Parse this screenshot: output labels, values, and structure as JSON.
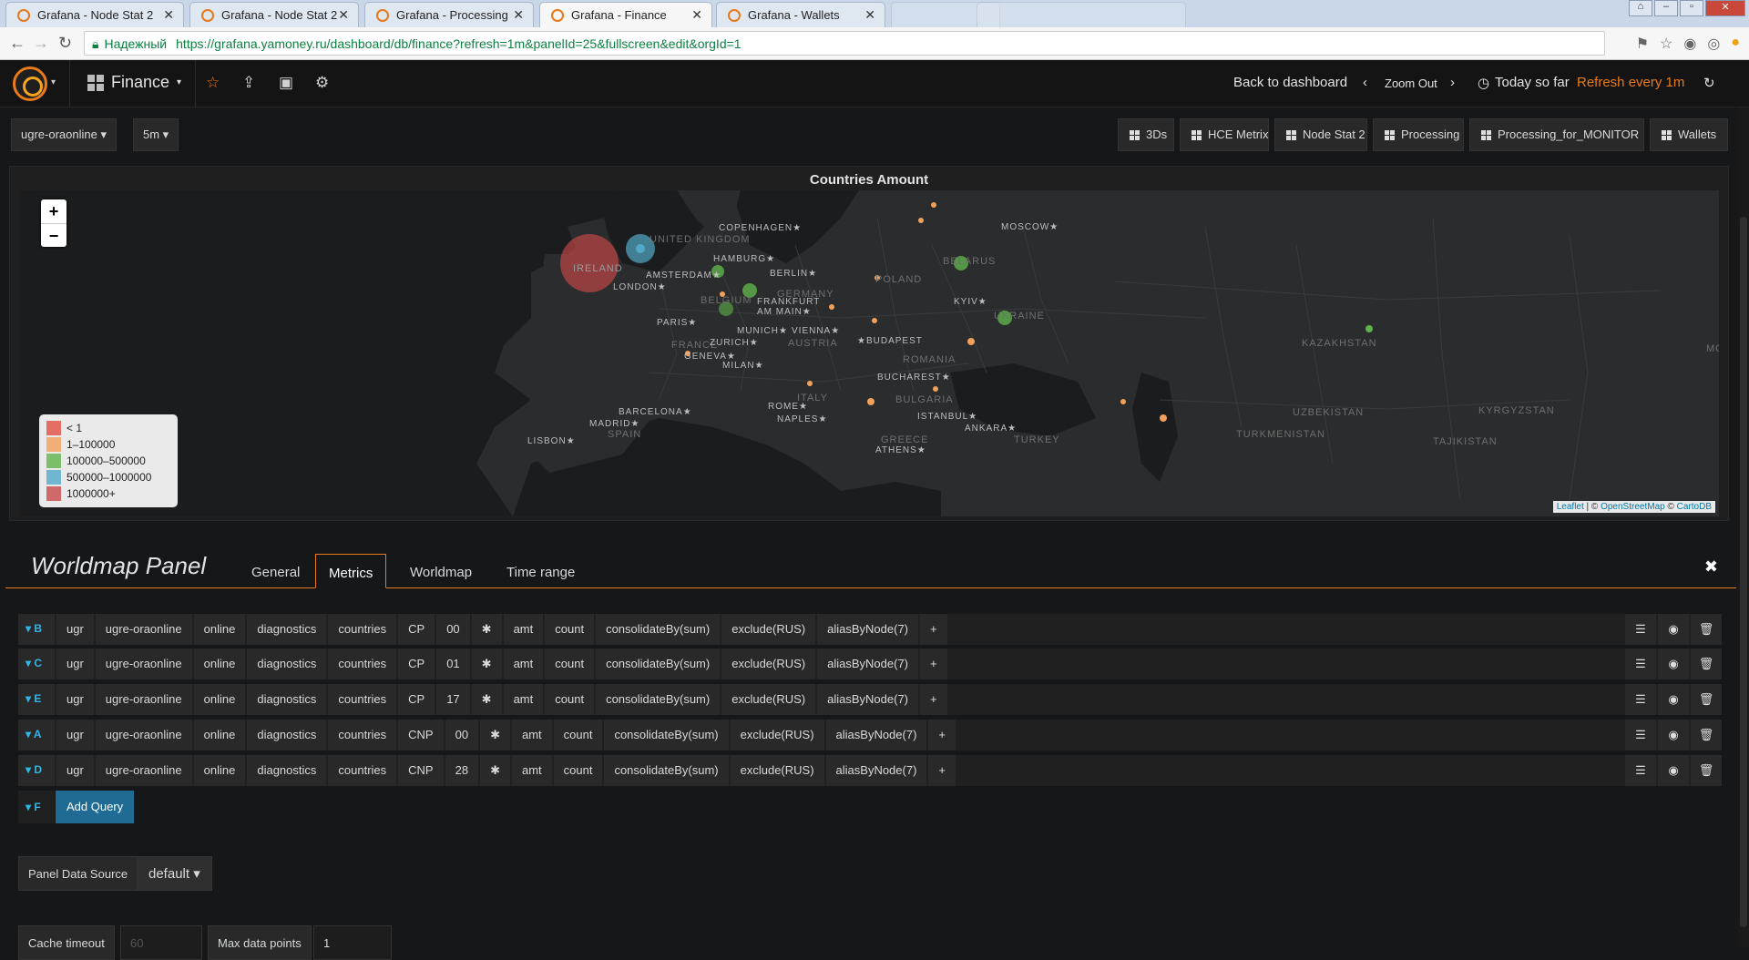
{
  "browser": {
    "tabs": [
      {
        "title": "Grafana - Node Stat 2",
        "active": false
      },
      {
        "title": "Grafana - Node Stat 2",
        "active": false
      },
      {
        "title": "Grafana - Processing",
        "active": false
      },
      {
        "title": "Grafana - Finance",
        "active": true
      },
      {
        "title": "Grafana - Wallets",
        "active": false
      }
    ],
    "secure_label": "Надежный",
    "url": "https://grafana.yamoney.ru/dashboard/db/finance?refresh=1m&panelId=25&fullscreen&edit&orgId=1"
  },
  "navbar": {
    "dashboard_title": "Finance",
    "back_label": "Back to dashboard",
    "zoom_out_label": "Zoom Out",
    "time_range_label": "Today so far",
    "refresh_label": "Refresh every 1m"
  },
  "variables": {
    "host": "ugre-oraonline",
    "interval": "5m"
  },
  "dashboard_links": [
    "3Ds",
    "HCE Metrix",
    "Node Stat 2",
    "Processing",
    "Processing_for_MONITOR",
    "Wallets"
  ],
  "panel": {
    "title": "Countries Amount",
    "legend": [
      {
        "label": "< 1",
        "color": "#e24d42"
      },
      {
        "label": "1–100000",
        "color": "#f2a05a"
      },
      {
        "label": "100000–500000",
        "color": "#5fb34b"
      },
      {
        "label": "500000–1000000",
        "color": "#52a9c9"
      },
      {
        "label": "1000000+",
        "color": "#c9484a"
      }
    ],
    "attribution": {
      "leaflet": "Leaflet",
      "sep": " | © ",
      "osm": "OpenStreetMap",
      "sep2": " © ",
      "carto": "CartoDB"
    },
    "cities": [
      "COPENHAGEN",
      "MOSCOW",
      "HAMBURG",
      "BERLIN",
      "AMSTERDAM",
      "LONDON",
      "FRANKFURT AM MAIN",
      "PARIS",
      "MUNICH",
      "VIENNA",
      "BUDAPEST",
      "ZURICH",
      "GENEVA",
      "MILAN",
      "KYIV",
      "BUCHAREST",
      "BARCELONA",
      "MADRID",
      "ROME",
      "NAPLES",
      "ISTANBUL",
      "ANKARA",
      "LISBON",
      "ATHENS"
    ],
    "countries": [
      "UNITED KINGDOM",
      "IRELAND",
      "BELARUS",
      "POLAND",
      "GERMANY",
      "BELGIUM",
      "UKRAINE",
      "FRANCE",
      "AUSTRIA",
      "ROMANIA",
      "ITALY",
      "BULGARIA",
      "SPAIN",
      "GREECE",
      "TURKEY",
      "KAZAKHSTAN",
      "UZBEKISTAN",
      "KYRGYZSTAN",
      "TURKMENISTAN",
      "TAJIKISTAN",
      "MO"
    ]
  },
  "editor": {
    "title": "Worldmap Panel",
    "tabs": [
      "General",
      "Metrics",
      "Worldmap",
      "Time range"
    ],
    "active_tab": "Metrics",
    "queries": [
      {
        "ref": "B",
        "segs": [
          "ugr",
          "ugre-oraonline",
          "online",
          "diagnostics",
          "countries",
          "CP",
          "00",
          "✱",
          "amt",
          "count",
          "consolidateBy(sum)",
          "exclude(RUS)",
          "aliasByNode(7)",
          "+"
        ]
      },
      {
        "ref": "C",
        "segs": [
          "ugr",
          "ugre-oraonline",
          "online",
          "diagnostics",
          "countries",
          "CP",
          "01",
          "✱",
          "amt",
          "count",
          "consolidateBy(sum)",
          "exclude(RUS)",
          "aliasByNode(7)",
          "+"
        ]
      },
      {
        "ref": "E",
        "segs": [
          "ugr",
          "ugre-oraonline",
          "online",
          "diagnostics",
          "countries",
          "CP",
          "17",
          "✱",
          "amt",
          "count",
          "consolidateBy(sum)",
          "exclude(RUS)",
          "aliasByNode(7)",
          "+"
        ]
      },
      {
        "ref": "A",
        "segs": [
          "ugr",
          "ugre-oraonline",
          "online",
          "diagnostics",
          "countries",
          "CNP",
          "00",
          "✱",
          "amt",
          "count",
          "consolidateBy(sum)",
          "exclude(RUS)",
          "aliasByNode(7)",
          "+"
        ]
      },
      {
        "ref": "D",
        "segs": [
          "ugr",
          "ugre-oraonline",
          "online",
          "diagnostics",
          "countries",
          "CNP",
          "28",
          "✱",
          "amt",
          "count",
          "consolidateBy(sum)",
          "exclude(RUS)",
          "aliasByNode(7)",
          "+"
        ]
      }
    ],
    "new_ref": "F",
    "add_query_label": "Add Query",
    "data_source_label": "Panel Data Source",
    "data_source_value": "default",
    "cache_timeout_label": "Cache timeout",
    "cache_timeout_placeholder": "60",
    "max_points_label": "Max data points",
    "max_points_value": "1"
  }
}
